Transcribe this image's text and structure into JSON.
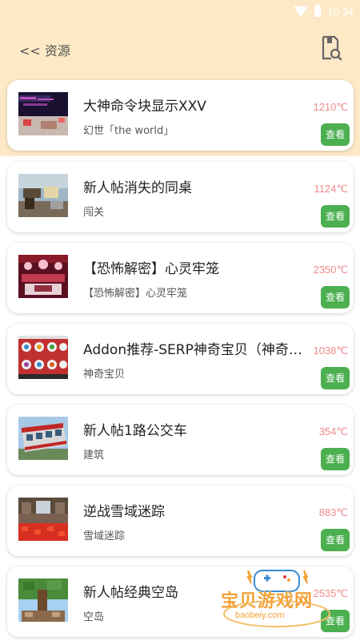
{
  "status": {
    "time": "10:34"
  },
  "header": {
    "back_label": "<< 资源"
  },
  "items": [
    {
      "title": "大神命令块显示XXV",
      "subtitle": "幻世「the world」",
      "temperature": "1210℃",
      "button": "查看"
    },
    {
      "title": "新人帖消失的同桌",
      "subtitle": "闯关",
      "temperature": "1124℃",
      "button": "查看"
    },
    {
      "title": "【恐怖解密】心灵牢笼",
      "subtitle": "【恐怖解密】心灵牢笼",
      "temperature": "2350℃",
      "button": "查看"
    },
    {
      "title": "Addon推荐-SERP神奇宝贝（神奇宝...",
      "subtitle": "神奇宝贝",
      "temperature": "1038℃",
      "button": "查看"
    },
    {
      "title": "新人帖1路公交车",
      "subtitle": "建筑",
      "temperature": "354℃",
      "button": "查看"
    },
    {
      "title": "逆战雪域迷踪",
      "subtitle": "雪域迷踪",
      "temperature": "883℃",
      "button": "查看"
    },
    {
      "title": "新人帖经典空岛",
      "subtitle": "空岛",
      "temperature": "2535℃",
      "button": "查看"
    }
  ],
  "watermark": {
    "text": "宝贝游戏网",
    "url": "baobeiy.com"
  },
  "colors": {
    "accent_green": "#4caf50",
    "temperature": "#ef8b8b",
    "header_bg": "#fde9c5"
  }
}
